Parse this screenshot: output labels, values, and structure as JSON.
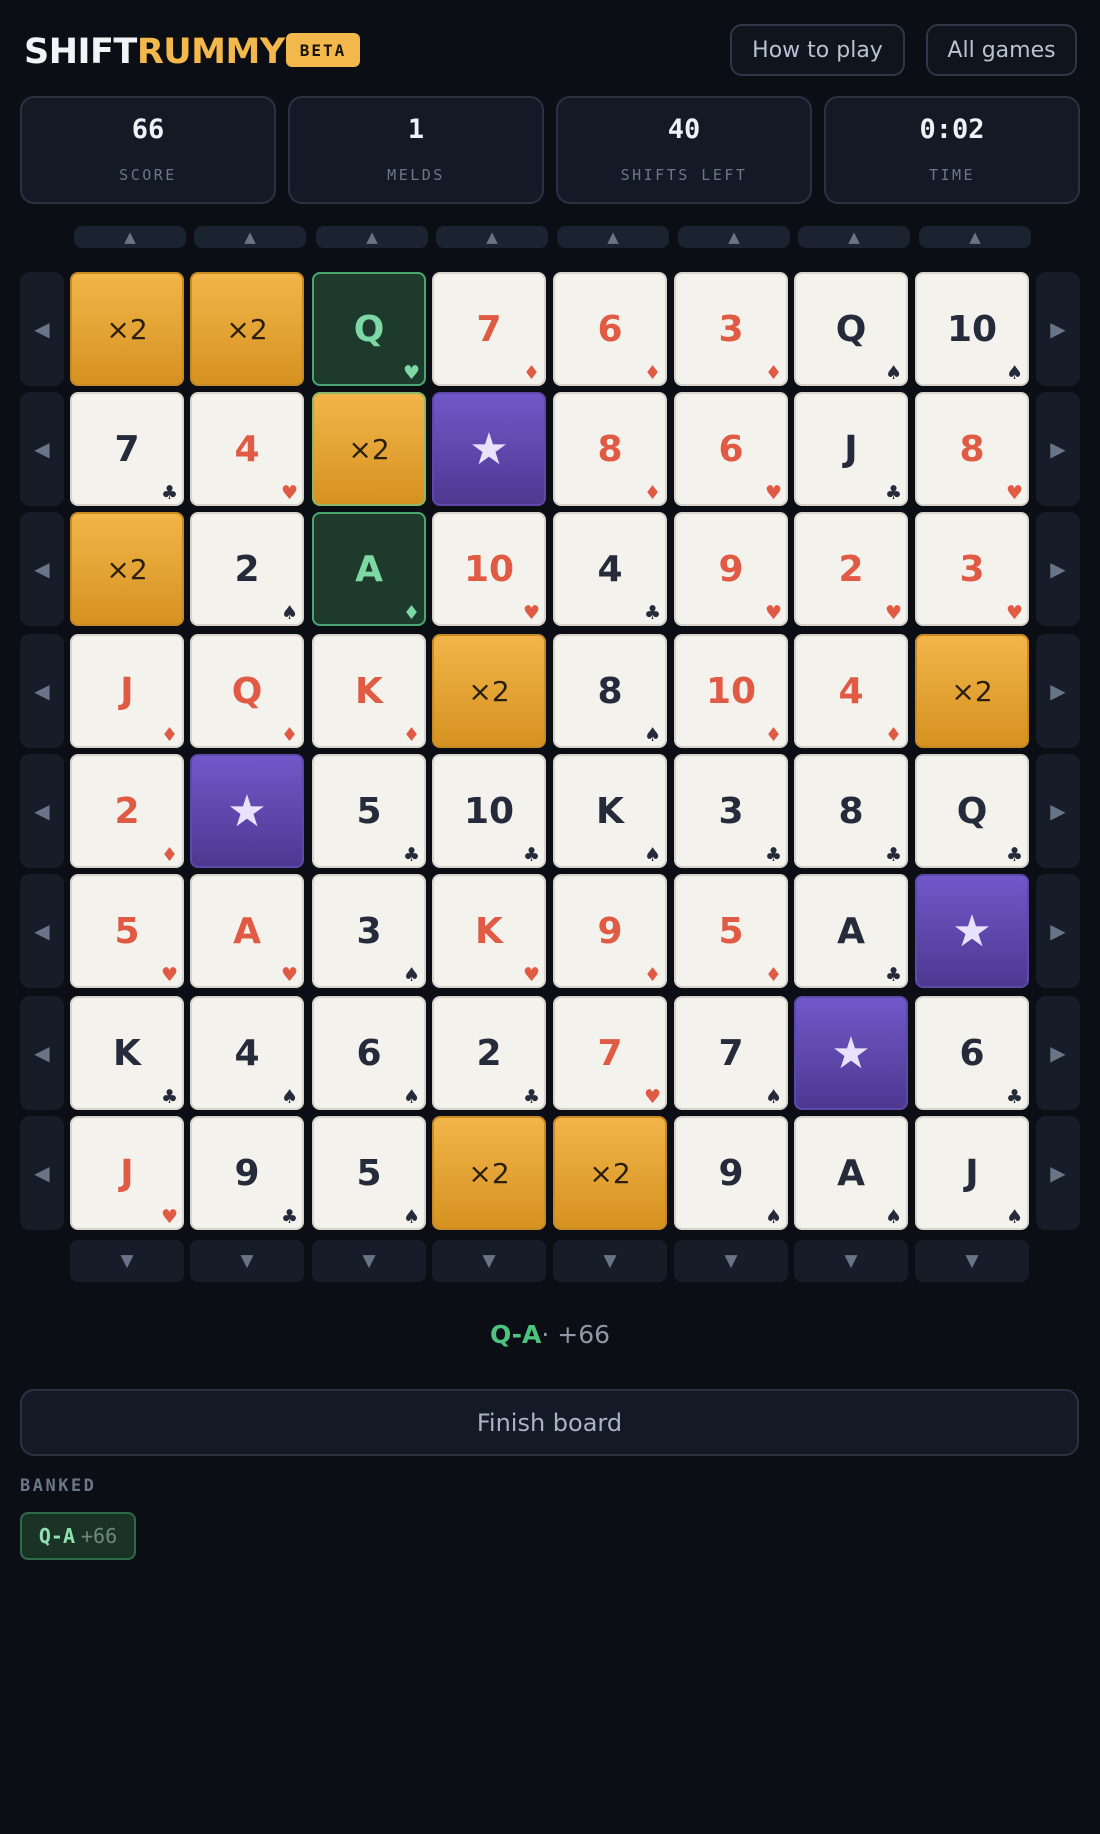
{
  "header": {
    "logo_part1": "SHIFT",
    "logo_part2": "RUMMY",
    "badge": "BETA",
    "how_to_play": "How to play",
    "all_games": "All games"
  },
  "stats": [
    {
      "value": "66",
      "label": "SCORE"
    },
    {
      "value": "1",
      "label": "MELDS"
    },
    {
      "value": "40",
      "label": "SHIFTS LEFT"
    },
    {
      "value": "0:02",
      "label": "TIME"
    }
  ],
  "arrows": {
    "up": "▲",
    "down": "▼",
    "left": "◀",
    "right": "▶"
  },
  "board": [
    [
      {
        "kind": "mult",
        "text": "×2"
      },
      {
        "kind": "mult",
        "text": "×2"
      },
      {
        "kind": "sel",
        "text": "Q",
        "suit": "♥"
      },
      {
        "kind": "card",
        "text": "7",
        "suit": "♦",
        "red": true
      },
      {
        "kind": "card",
        "text": "6",
        "suit": "♦",
        "red": true
      },
      {
        "kind": "card",
        "text": "3",
        "suit": "♦",
        "red": true
      },
      {
        "kind": "card",
        "text": "Q",
        "suit": "♠"
      },
      {
        "kind": "card",
        "text": "10",
        "suit": "♠"
      }
    ],
    [
      {
        "kind": "card",
        "text": "7",
        "suit": "♣"
      },
      {
        "kind": "card",
        "text": "4",
        "suit": "♥",
        "red": true
      },
      {
        "kind": "mult",
        "text": "×2",
        "selm": true
      },
      {
        "kind": "star",
        "text": "★"
      },
      {
        "kind": "card",
        "text": "8",
        "suit": "♦",
        "red": true
      },
      {
        "kind": "card",
        "text": "6",
        "suit": "♥",
        "red": true
      },
      {
        "kind": "card",
        "text": "J",
        "suit": "♣"
      },
      {
        "kind": "card",
        "text": "8",
        "suit": "♥",
        "red": true
      }
    ],
    [
      {
        "kind": "mult",
        "text": "×2"
      },
      {
        "kind": "card",
        "text": "2",
        "suit": "♠"
      },
      {
        "kind": "sel",
        "text": "A",
        "suit": "♦"
      },
      {
        "kind": "card",
        "text": "10",
        "suit": "♥",
        "red": true
      },
      {
        "kind": "card",
        "text": "4",
        "suit": "♣"
      },
      {
        "kind": "card",
        "text": "9",
        "suit": "♥",
        "red": true
      },
      {
        "kind": "card",
        "text": "2",
        "suit": "♥",
        "red": true
      },
      {
        "kind": "card",
        "text": "3",
        "suit": "♥",
        "red": true
      }
    ],
    [
      {
        "kind": "card",
        "text": "J",
        "suit": "♦",
        "red": true
      },
      {
        "kind": "card",
        "text": "Q",
        "suit": "♦",
        "red": true
      },
      {
        "kind": "card",
        "text": "K",
        "suit": "♦",
        "red": true
      },
      {
        "kind": "mult",
        "text": "×2"
      },
      {
        "kind": "card",
        "text": "8",
        "suit": "♠"
      },
      {
        "kind": "card",
        "text": "10",
        "suit": "♦",
        "red": true
      },
      {
        "kind": "card",
        "text": "4",
        "suit": "♦",
        "red": true
      },
      {
        "kind": "mult",
        "text": "×2"
      }
    ],
    [
      {
        "kind": "card",
        "text": "2",
        "suit": "♦",
        "red": true
      },
      {
        "kind": "star",
        "text": "★"
      },
      {
        "kind": "card",
        "text": "5",
        "suit": "♣"
      },
      {
        "kind": "card",
        "text": "10",
        "suit": "♣"
      },
      {
        "kind": "card",
        "text": "K",
        "suit": "♠"
      },
      {
        "kind": "card",
        "text": "3",
        "suit": "♣"
      },
      {
        "kind": "card",
        "text": "8",
        "suit": "♣"
      },
      {
        "kind": "card",
        "text": "Q",
        "suit": "♣"
      }
    ],
    [
      {
        "kind": "card",
        "text": "5",
        "suit": "♥",
        "red": true
      },
      {
        "kind": "card",
        "text": "A",
        "suit": "♥",
        "red": true
      },
      {
        "kind": "card",
        "text": "3",
        "suit": "♠"
      },
      {
        "kind": "card",
        "text": "K",
        "suit": "♥",
        "red": true
      },
      {
        "kind": "card",
        "text": "9",
        "suit": "♦",
        "red": true
      },
      {
        "kind": "card",
        "text": "5",
        "suit": "♦",
        "red": true
      },
      {
        "kind": "card",
        "text": "A",
        "suit": "♣"
      },
      {
        "kind": "star",
        "text": "★"
      }
    ],
    [
      {
        "kind": "card",
        "text": "K",
        "suit": "♣"
      },
      {
        "kind": "card",
        "text": "4",
        "suit": "♠"
      },
      {
        "kind": "card",
        "text": "6",
        "suit": "♠"
      },
      {
        "kind": "card",
        "text": "2",
        "suit": "♣"
      },
      {
        "kind": "card",
        "text": "7",
        "suit": "♥",
        "red": true
      },
      {
        "kind": "card",
        "text": "7",
        "suit": "♠"
      },
      {
        "kind": "star",
        "text": "★"
      },
      {
        "kind": "card",
        "text": "6",
        "suit": "♣"
      }
    ],
    [
      {
        "kind": "card",
        "text": "J",
        "suit": "♥",
        "red": true
      },
      {
        "kind": "card",
        "text": "9",
        "suit": "♣"
      },
      {
        "kind": "card",
        "text": "5",
        "suit": "♠"
      },
      {
        "kind": "mult",
        "text": "×2"
      },
      {
        "kind": "mult",
        "text": "×2"
      },
      {
        "kind": "card",
        "text": "9",
        "suit": "♠"
      },
      {
        "kind": "card",
        "text": "A",
        "suit": "♠"
      },
      {
        "kind": "card",
        "text": "J",
        "suit": "♠"
      }
    ]
  ],
  "meld": {
    "name": "Q-A",
    "sep": "·",
    "points": "+66"
  },
  "finish_label": "Finish board",
  "banked": {
    "label": "BANKED",
    "items": [
      {
        "name": "Q-A",
        "points": "+66"
      }
    ]
  },
  "colors": {
    "background": "#0b0e14",
    "accent_gold": "#f2b84b",
    "accent_green": "#4cc37f",
    "star_purple": "#6a52c0",
    "red_suit": "#e05a44"
  }
}
